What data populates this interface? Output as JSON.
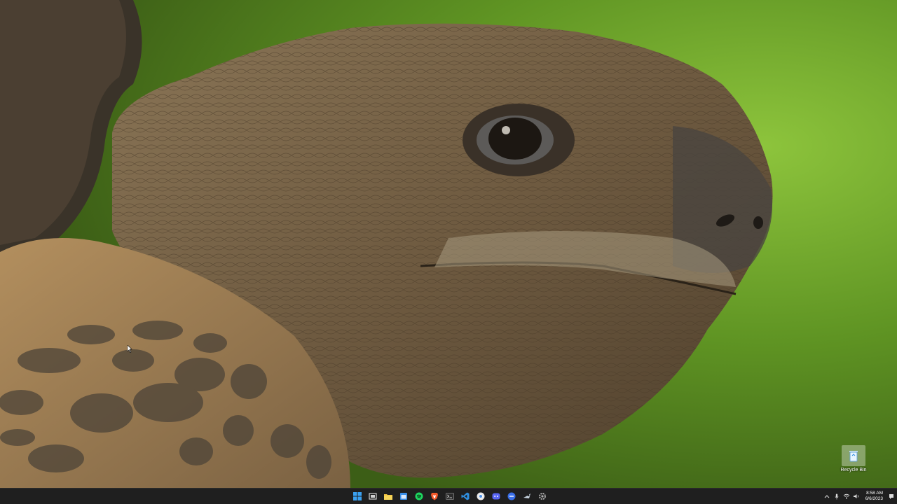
{
  "desktop": {
    "wallpaper": "giant tortoise head close-up on green background",
    "icons": [
      {
        "label": "Recycle Bin",
        "icon": "recycle-bin-icon"
      }
    ]
  },
  "taskbar": {
    "apps": [
      {
        "name": "start",
        "icon": "windows-logo-icon",
        "color": "#3aa0f0"
      },
      {
        "name": "task-view",
        "icon": "task-view-icon",
        "color": "#d0d0d0"
      },
      {
        "name": "file-explorer",
        "icon": "folder-icon",
        "color": "#f4c542"
      },
      {
        "name": "calendar",
        "icon": "calendar-icon",
        "color": "#3a8fe8"
      },
      {
        "name": "spotify",
        "icon": "spotify-icon",
        "color": "#1ed760"
      },
      {
        "name": "brave",
        "icon": "brave-icon",
        "color": "#f15a2b"
      },
      {
        "name": "terminal",
        "icon": "terminal-icon",
        "color": "#888888"
      },
      {
        "name": "vscode",
        "icon": "vscode-icon",
        "color": "#2f8fe0"
      },
      {
        "name": "chrome",
        "icon": "chrome-icon",
        "color": "#e8e8e8"
      },
      {
        "name": "discord",
        "icon": "discord-icon",
        "color": "#5865f2"
      },
      {
        "name": "app-blue",
        "icon": "minus-circle-icon",
        "color": "#3a6fe8"
      },
      {
        "name": "steam",
        "icon": "steam-icon",
        "color": "#c7d5e0"
      },
      {
        "name": "settings",
        "icon": "gear-icon",
        "color": "#b0b0b0"
      }
    ],
    "tray": {
      "icons": [
        "chevron-up-icon",
        "microphone-icon",
        "wifi-icon",
        "speaker-icon"
      ],
      "time": "8:58 AM",
      "date": "6/6/2023",
      "notification_icon": "notification-icon"
    }
  }
}
